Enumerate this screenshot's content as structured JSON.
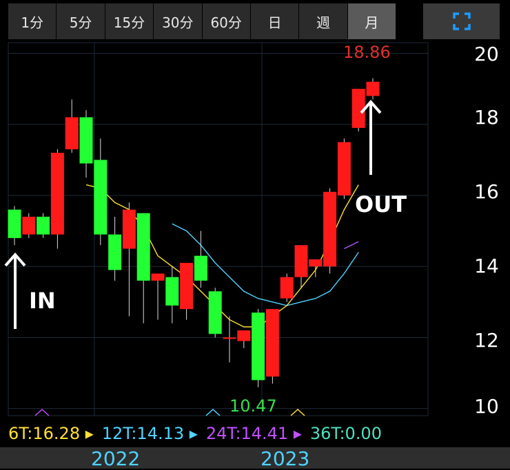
{
  "tabs": [
    {
      "label": "1分",
      "active": false
    },
    {
      "label": "5分",
      "active": false
    },
    {
      "label": "15分",
      "active": false
    },
    {
      "label": "30分",
      "active": false
    },
    {
      "label": "60分",
      "active": false
    },
    {
      "label": "日",
      "active": false
    },
    {
      "label": "週",
      "active": false
    },
    {
      "label": "月",
      "active": true
    }
  ],
  "fullscreen_icon": "expand-icon",
  "legend": {
    "ma6": {
      "text": "6T:16.28",
      "color": "#ffe033"
    },
    "ma12": {
      "text": "12T:14.13",
      "color": "#4fd4ff"
    },
    "ma24": {
      "text": "24T:14.41",
      "color": "#c050ff"
    },
    "ma36": {
      "text": "36T:0.00",
      "color": "#4de0c0"
    }
  },
  "annotations": {
    "in_label": "IN",
    "out_label": "OUT"
  },
  "chart_data": {
    "type": "candlestick",
    "ylim": [
      9.8,
      20.3
    ],
    "y_ticks": [
      "20",
      "18",
      "16",
      "14",
      "12",
      "10"
    ],
    "x_labels": [
      "2022",
      "2023"
    ],
    "high_label": "18.86",
    "low_label": "10.47",
    "colors": {
      "up": "#ff1a1a",
      "down": "#22ff33"
    },
    "candles": [
      {
        "o": 15.6,
        "h": 15.7,
        "c": 14.8,
        "l": 14.6
      },
      {
        "o": 14.9,
        "h": 15.5,
        "c": 15.4,
        "l": 14.8
      },
      {
        "o": 15.4,
        "h": 15.5,
        "c": 14.9,
        "l": 14.8
      },
      {
        "o": 14.9,
        "h": 17.3,
        "c": 17.2,
        "l": 14.5
      },
      {
        "o": 17.3,
        "h": 18.7,
        "c": 18.2,
        "l": 17.2
      },
      {
        "o": 18.2,
        "h": 18.4,
        "c": 16.9,
        "l": 16.5
      },
      {
        "o": 17.0,
        "h": 17.6,
        "c": 14.9,
        "l": 14.6
      },
      {
        "o": 14.9,
        "h": 15.4,
        "c": 13.9,
        "l": 13.6
      },
      {
        "o": 14.5,
        "h": 15.8,
        "c": 15.6,
        "l": 12.6
      },
      {
        "o": 15.5,
        "h": 15.5,
        "c": 13.6,
        "l": 12.4
      },
      {
        "o": 13.6,
        "h": 13.7,
        "c": 13.8,
        "l": 12.5
      },
      {
        "o": 13.7,
        "h": 14.0,
        "c": 12.9,
        "l": 12.4
      },
      {
        "o": 12.8,
        "h": 14.1,
        "c": 14.1,
        "l": 12.5
      },
      {
        "o": 14.3,
        "h": 15.0,
        "c": 13.6,
        "l": 13.4
      },
      {
        "o": 13.3,
        "h": 13.4,
        "c": 12.1,
        "l": 12.0
      },
      {
        "o": 12.0,
        "h": 12.6,
        "c": 12.0,
        "l": 11.3
      },
      {
        "o": 11.9,
        "h": 12.1,
        "c": 12.2,
        "l": 11.7
      },
      {
        "o": 12.7,
        "h": 12.8,
        "c": 10.8,
        "l": 10.6
      },
      {
        "o": 10.9,
        "h": 12.8,
        "c": 12.8,
        "l": 10.7
      },
      {
        "o": 13.1,
        "h": 13.8,
        "c": 13.7,
        "l": 13.0
      },
      {
        "o": 13.7,
        "h": 14.2,
        "c": 14.6,
        "l": 13.4
      },
      {
        "o": 14.0,
        "h": 14.2,
        "c": 14.2,
        "l": 13.7
      },
      {
        "o": 14.0,
        "h": 16.2,
        "c": 16.1,
        "l": 13.8
      },
      {
        "o": 16.0,
        "h": 17.6,
        "c": 17.5,
        "l": 15.9
      },
      {
        "o": 17.9,
        "h": 19.0,
        "c": 19.0,
        "l": 17.8
      },
      {
        "o": 18.8,
        "h": 19.3,
        "c": 19.2,
        "l": 18.7
      }
    ],
    "ma6": [
      null,
      null,
      null,
      null,
      null,
      16.3,
      16.2,
      15.8,
      15.6,
      15.1,
      14.3,
      14.0,
      13.7,
      13.3,
      12.9,
      12.5,
      12.3,
      12.3,
      12.6,
      12.9,
      13.4,
      13.9,
      14.7,
      15.6,
      16.3,
      null
    ],
    "ma12": [
      null,
      null,
      null,
      null,
      null,
      null,
      null,
      null,
      null,
      null,
      null,
      15.2,
      15.0,
      14.6,
      14.1,
      13.7,
      13.3,
      13.1,
      13.0,
      12.9,
      13.0,
      13.1,
      13.3,
      13.8,
      14.4,
      null
    ],
    "ma24": [
      null,
      null,
      null,
      null,
      null,
      null,
      null,
      null,
      null,
      null,
      null,
      null,
      null,
      null,
      null,
      null,
      null,
      null,
      null,
      null,
      null,
      null,
      null,
      14.5,
      14.7,
      null
    ]
  }
}
